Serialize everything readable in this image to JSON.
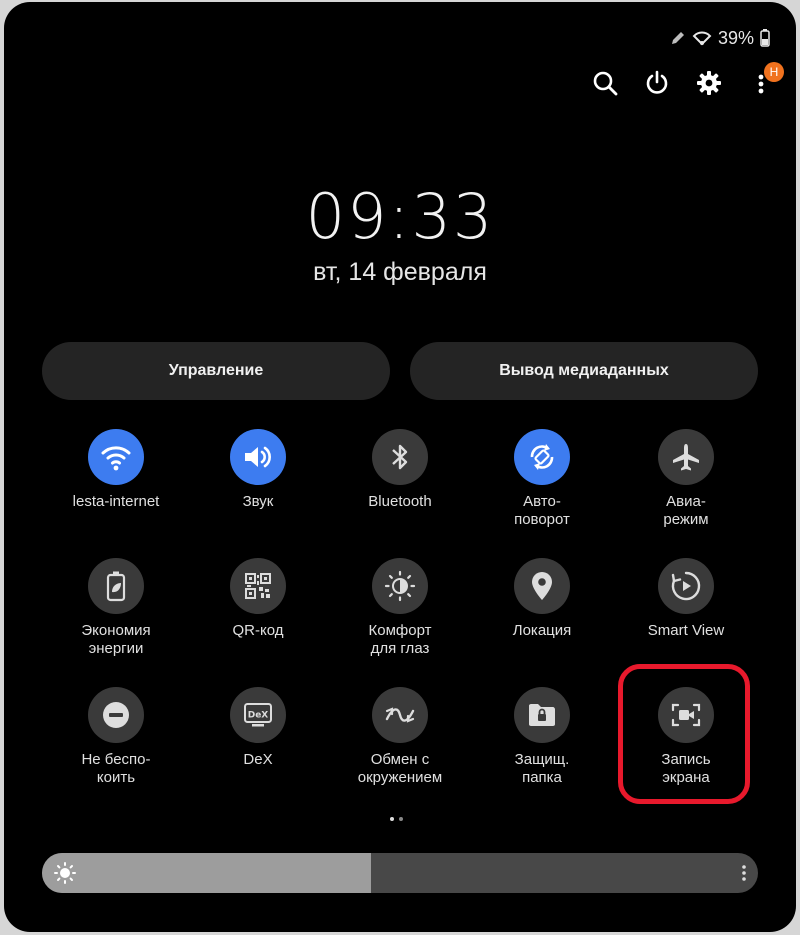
{
  "status": {
    "battery": "39%"
  },
  "header": {
    "avatar_letter": "H",
    "badge_color": "#f0721e"
  },
  "clock": {
    "time": "09:33",
    "date": "вт, 14 февраля"
  },
  "buttons": {
    "devices": "Управление",
    "media": "Вывод медиаданных"
  },
  "tiles": [
    {
      "label": "lesta-internet",
      "icon": "wifi-icon",
      "on": true
    },
    {
      "label": "Звук",
      "icon": "sound-icon",
      "on": true
    },
    {
      "label": "Bluetooth",
      "icon": "bluetooth-icon",
      "on": false
    },
    {
      "label": "Авто-\nповорот",
      "icon": "auto-rotate-icon",
      "on": true
    },
    {
      "label": "Авиа-\nрежим",
      "icon": "airplane-icon",
      "on": false
    },
    {
      "label": "Экономия\nэнергии",
      "icon": "power-saving-icon",
      "on": false
    },
    {
      "label": "QR-код",
      "icon": "qr-code-icon",
      "on": false
    },
    {
      "label": "Комфорт\nдля глаз",
      "icon": "eye-comfort-icon",
      "on": false
    },
    {
      "label": "Локация",
      "icon": "location-icon",
      "on": false
    },
    {
      "label": "Smart View",
      "icon": "smart-view-icon",
      "on": false
    },
    {
      "label": "Не беспо-\nкоить",
      "icon": "do-not-disturb-icon",
      "on": false
    },
    {
      "label": "DeX",
      "icon": "dex-icon",
      "on": false
    },
    {
      "label": "Обмен с\nокружением",
      "icon": "nearby-share-icon",
      "on": false
    },
    {
      "label": "Защищ.\nпапка",
      "icon": "secure-folder-icon",
      "on": false
    },
    {
      "label": "Запись\nэкрана",
      "icon": "screen-record-icon",
      "on": false
    }
  ],
  "brightness": {
    "level": 0.46
  },
  "colors": {
    "active_tile": "#3d7cf0",
    "highlight": "#e8192c"
  }
}
